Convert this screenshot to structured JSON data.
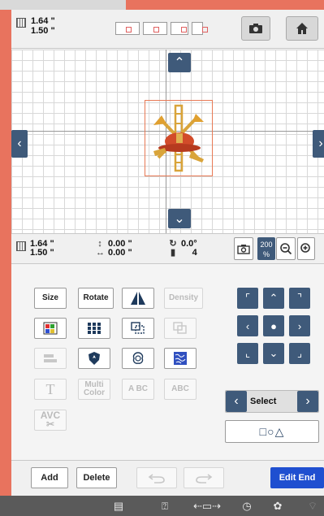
{
  "top_bar": {
    "width": "1.64 \"",
    "height": "1.50 \"",
    "icons": {
      "size": "size-icon",
      "camera": "camera-icon",
      "home": "home-icon"
    }
  },
  "canvas": {
    "scroll_up_glyph": "⌃",
    "scroll_down_glyph": "⌄",
    "scroll_left_glyph": "‹",
    "scroll_right_glyph": "›"
  },
  "info_bar": {
    "width": "1.64 \"",
    "height": "1.50 \"",
    "x_offset": "0.00 \"",
    "y_offset": "0.00 \"",
    "angle": "0.0°",
    "color_count": "4",
    "zoom": "200",
    "zoom_unit": "%"
  },
  "tools": {
    "size": "Size",
    "rotate": "Rotate",
    "density": "Density",
    "multi_color": "Multi Color",
    "text_abc": "A BC",
    "text_abc_box": "ABC"
  },
  "select": {
    "label": "Select",
    "shapes": "□○△"
  },
  "actions": {
    "add": "Add",
    "delete": "Delete",
    "edit_end": "Edit End"
  },
  "colors": {
    "frame": "#e8735e",
    "dark_button": "#3f5a7a",
    "edit_end": "#1f4fd0"
  }
}
